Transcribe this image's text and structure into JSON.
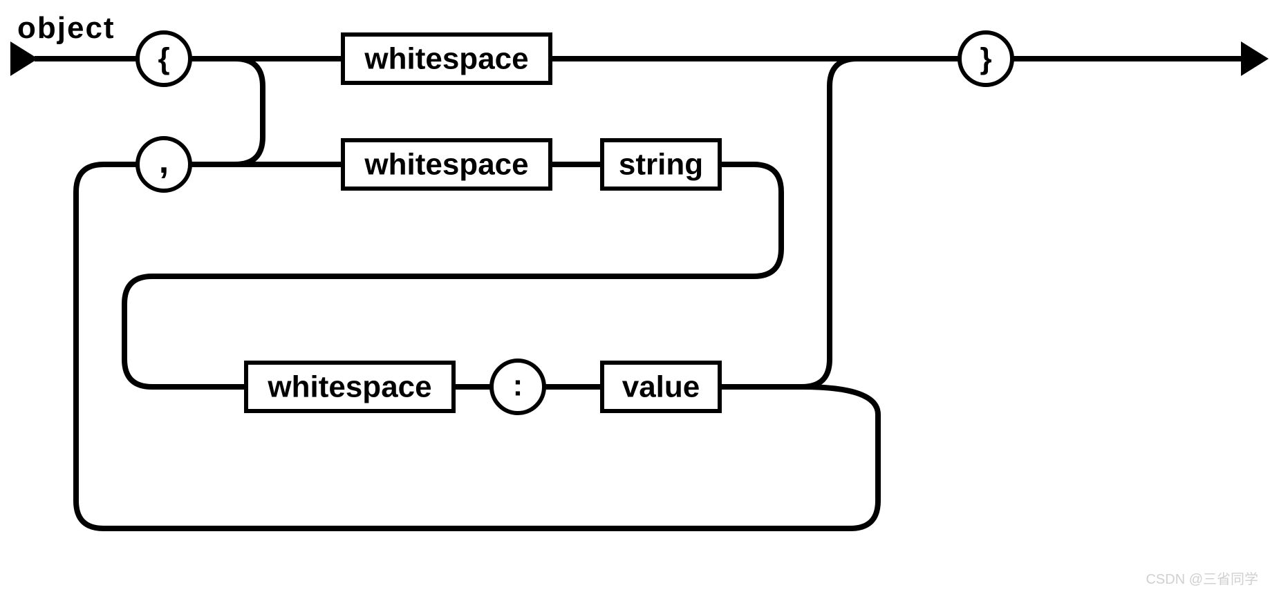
{
  "diagram": {
    "title": "object",
    "terminals": {
      "open_brace": "{",
      "close_brace": "}",
      "comma": ",",
      "colon": ":"
    },
    "nonterminals": {
      "whitespace_top": "whitespace",
      "whitespace_mid": "whitespace",
      "string_mid": "string",
      "whitespace_bottom": "whitespace",
      "value_bottom": "value"
    }
  },
  "watermark": "CSDN @三省同学"
}
